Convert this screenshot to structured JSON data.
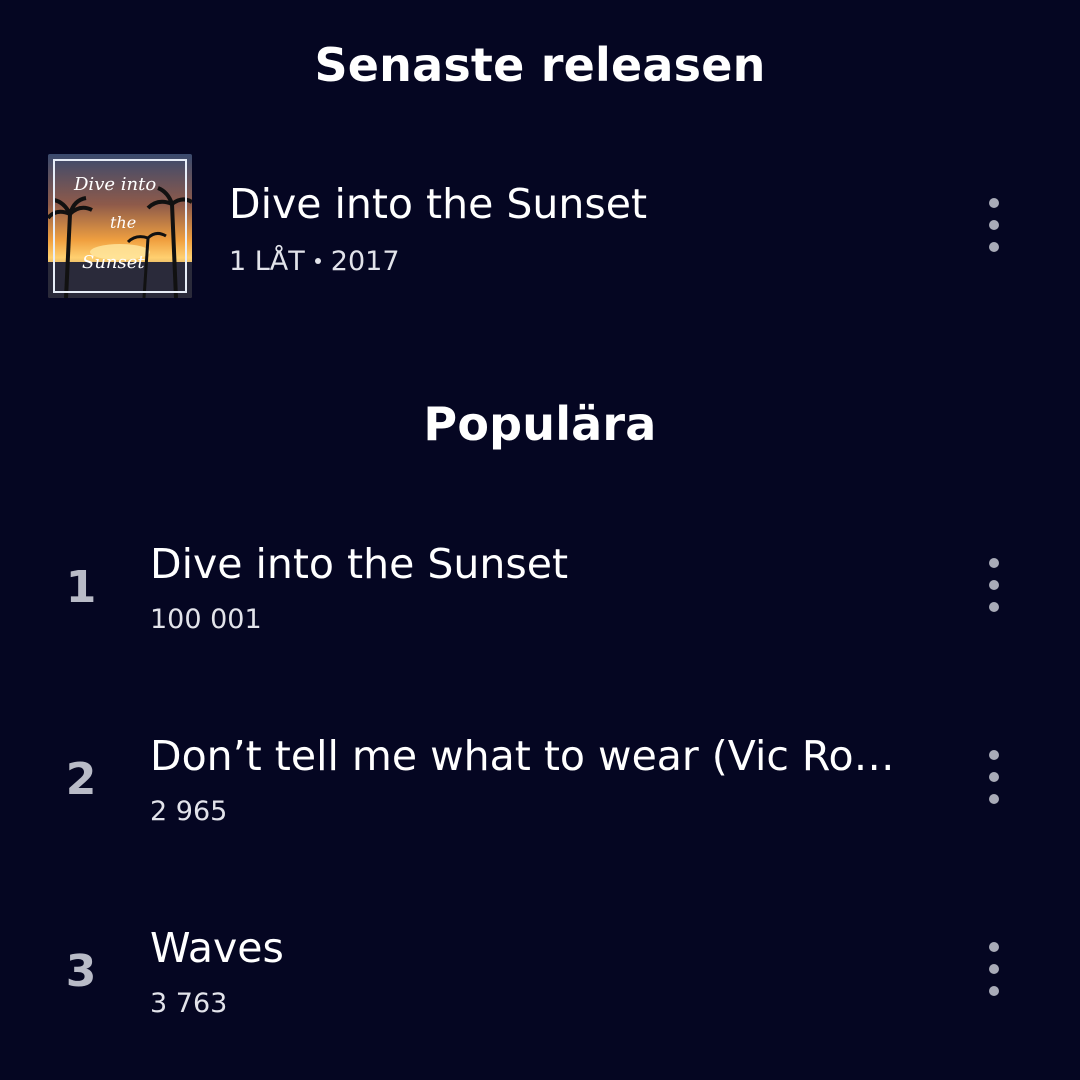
{
  "latest_release": {
    "section_title": "Senaste releasen",
    "title": "Dive into the Sunset",
    "track_count": "1 LÅT",
    "year": "2017",
    "cover_text": [
      "Dive into",
      "the",
      "Sunset"
    ]
  },
  "popular": {
    "section_title": "Populära",
    "tracks": [
      {
        "number": "1",
        "title": "Dive into the Sunset",
        "plays": "100 001"
      },
      {
        "number": "2",
        "title": "Don’t tell me what to wear (Vic Ro…",
        "plays": "2 965"
      },
      {
        "number": "3",
        "title": "Waves",
        "plays": "3 763"
      }
    ]
  },
  "icons": {
    "more": "more-vertical-icon"
  },
  "colors": {
    "background": "#050622",
    "text_primary": "#ffffff",
    "text_secondary": "#e2e3ea",
    "track_number": "#b9bbc7",
    "more_icon": "#a9abb8"
  }
}
